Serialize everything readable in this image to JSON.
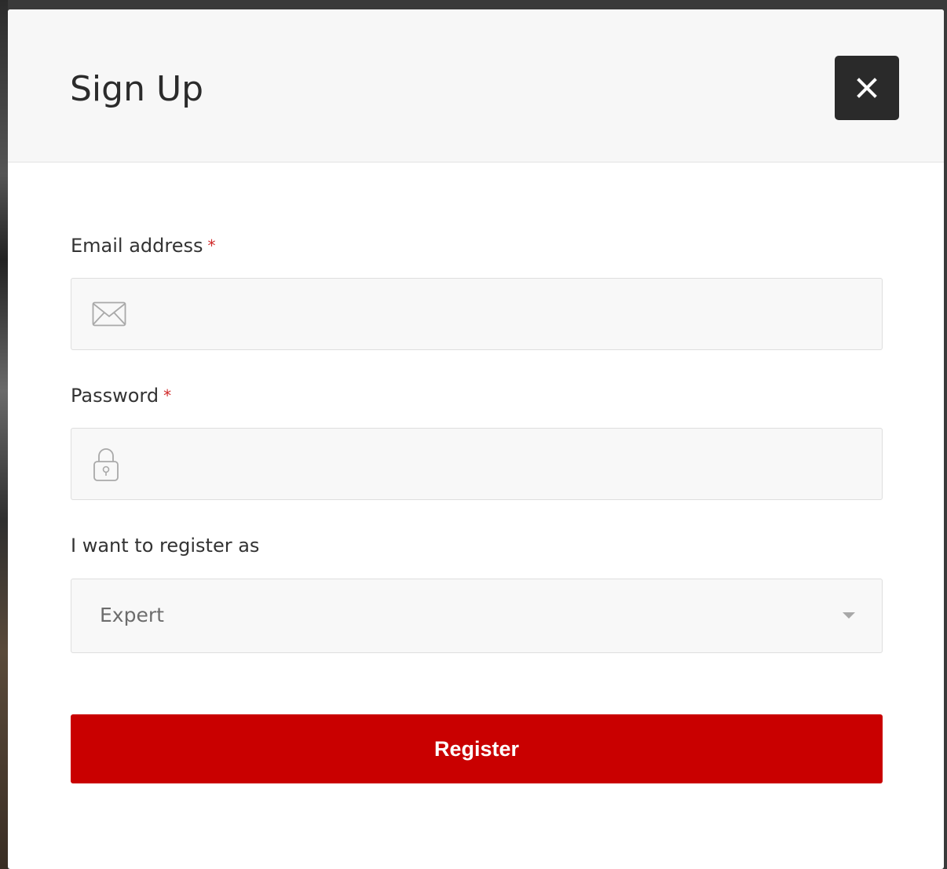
{
  "modal": {
    "title": "Sign Up",
    "close_icon": "close-icon"
  },
  "form": {
    "email": {
      "label": "Email address",
      "required_mark": "*",
      "value": "",
      "placeholder": "",
      "icon": "envelope-icon"
    },
    "password": {
      "label": "Password",
      "required_mark": "*",
      "value": "",
      "placeholder": "",
      "icon": "lock-icon"
    },
    "role": {
      "label": "I want to register as",
      "selected": "Expert",
      "icon": "chevron-down-icon"
    },
    "submit_label": "Register"
  },
  "colors": {
    "accent": "#c90000",
    "required": "#d02a2a",
    "header_bg": "#f7f7f7",
    "close_bg": "#2a2a2a"
  }
}
